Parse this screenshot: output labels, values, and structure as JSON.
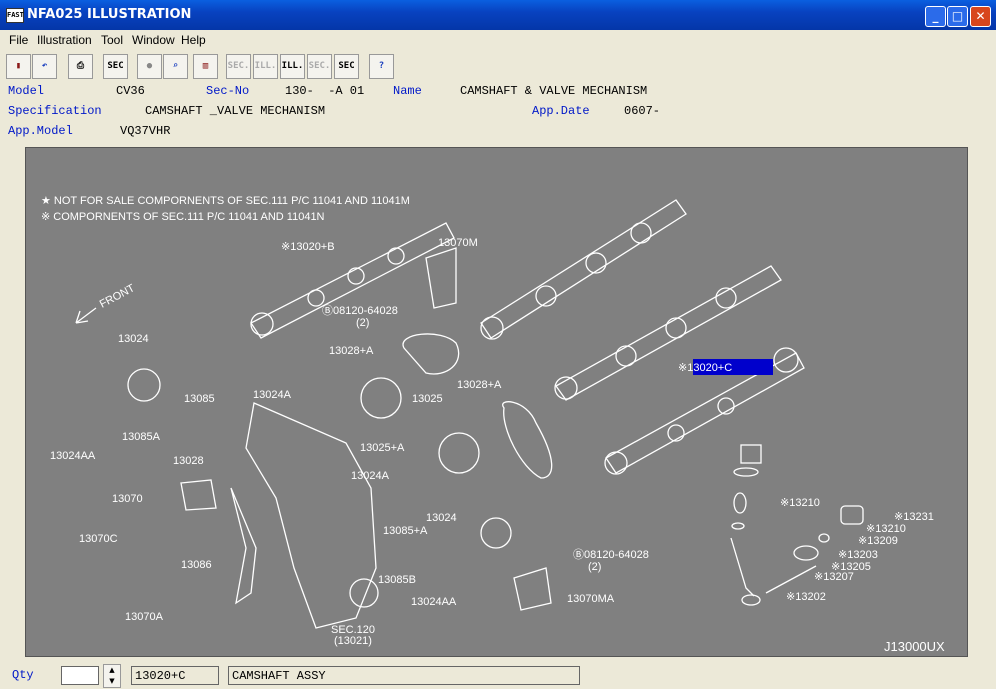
{
  "window": {
    "title": "NFA025  ILLUSTRATION",
    "app_icon": "FAST",
    "min": "_",
    "max": "□",
    "close": "✕"
  },
  "menu": [
    "File",
    "Illustration",
    "Tool",
    "Window",
    "Help"
  ],
  "toolbar": {
    "sec_a": "SEC",
    "sec_b": "SEC.",
    "ill_a": "ILL.",
    "ill_b": "ILL.",
    "sec_c": "SEC.",
    "sec_d": "SEC",
    "help": "?"
  },
  "info": {
    "model_label": "Model",
    "model": "CV36",
    "secno_label": "Sec-No",
    "secno": "130-  -A 01",
    "name_label": "Name",
    "name": "CAMSHAFT & VALVE MECHANISM",
    "spec_label": "Specification",
    "spec": "CAMSHAFT _VALVE MECHANISM",
    "appdate_label": "App.Date",
    "appdate": "0607-",
    "appmodel_label": "App.Model",
    "appmodel": "VQ37VHR"
  },
  "illustration": {
    "note1": "★ NOT FOR SALE COMPORNENTS OF SEC.111 P/C 11041 AND 11041M",
    "note2": "※ COMPORNENTS OF SEC.111 P/C 11041 AND 11041N",
    "front": "FRONT",
    "code": "J13000UX",
    "selected": "※13020+C",
    "parts": {
      "p13020b": "※13020+B",
      "p13070m": "13070M",
      "p08120a": "Ⓑ08120-64028",
      "p08120a_q": "(2)",
      "p13024a": "13024",
      "p13028a": "13028+A",
      "p13028a2": "13028+A",
      "p13085": "13085",
      "p13024a_b": "13024A",
      "p13025": "13025",
      "p13085a": "13085A",
      "p13024aa": "13024AA",
      "p13028": "13028",
      "p13025a": "13025+A",
      "p13024a_c": "13024A",
      "p13070": "13070",
      "p13024b": "13024",
      "p13085a2": "13085+A",
      "p13070c": "13070C",
      "p13086": "13086",
      "p13085b": "13085B",
      "p13024aa2": "13024AA",
      "p13070a": "13070A",
      "p13070ma": "13070MA",
      "p08120b": "Ⓑ08120-64028",
      "p08120b_q": "(2)",
      "sec120": "SEC.120",
      "sec120b": "(13021)",
      "p13210": "※13210",
      "p13231": "※13231",
      "p13210b": "※13210",
      "p13209": "※13209",
      "p13203": "※13203",
      "p13205": "※13205",
      "p13207": "※13207",
      "p13202": "※13202"
    }
  },
  "status": {
    "qty_label": "Qty",
    "qty": "",
    "part_no": "13020+C",
    "part_name": "CAMSHAFT ASSY"
  }
}
